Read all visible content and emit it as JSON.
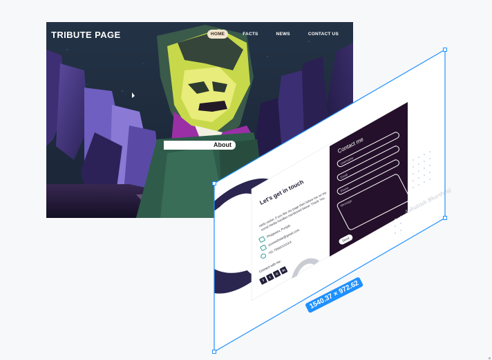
{
  "tribute": {
    "brand": "TRIBUTE PAGE",
    "nav": [
      {
        "label": "HOME",
        "active": true
      },
      {
        "label": "FACTS",
        "active": false
      },
      {
        "label": "NEWS",
        "active": false
      },
      {
        "label": "CONTACT US",
        "active": false
      }
    ],
    "hero_button": "About"
  },
  "contact": {
    "title": "Let's get in touch",
    "body": "Hello visitor, if you like my page then follow me on my social media handles mentioned below. Thank You",
    "info": [
      {
        "icon": "location-icon",
        "text": "Phagwara, Punjab"
      },
      {
        "icon": "mail-icon",
        "text": "yourwebsite@gmail.com"
      },
      {
        "icon": "phone-icon",
        "text": "+91 7056XXXXXX"
      }
    ],
    "connect_label": "Connect with me :",
    "social": [
      {
        "icon": "facebook-icon",
        "glyph": "f"
      },
      {
        "icon": "twitter-icon",
        "glyph": "t"
      },
      {
        "icon": "instagram-icon",
        "glyph": "◎"
      },
      {
        "icon": "linkedin-icon",
        "glyph": "in"
      }
    ],
    "form_title": "Contact me",
    "fields": {
      "username": "Username",
      "email": "Email",
      "phone": "Phone",
      "message": "Message"
    },
    "send": "Send",
    "signature": "Ashutosh Bhardwaj"
  },
  "selection": {
    "dimensions": "1540.37 × 972.62"
  },
  "colors": {
    "accent": "#1e90ff",
    "contact_dark": "#22152e",
    "form_panel": "#24102a",
    "teal_icon": "#2f9b8f"
  }
}
